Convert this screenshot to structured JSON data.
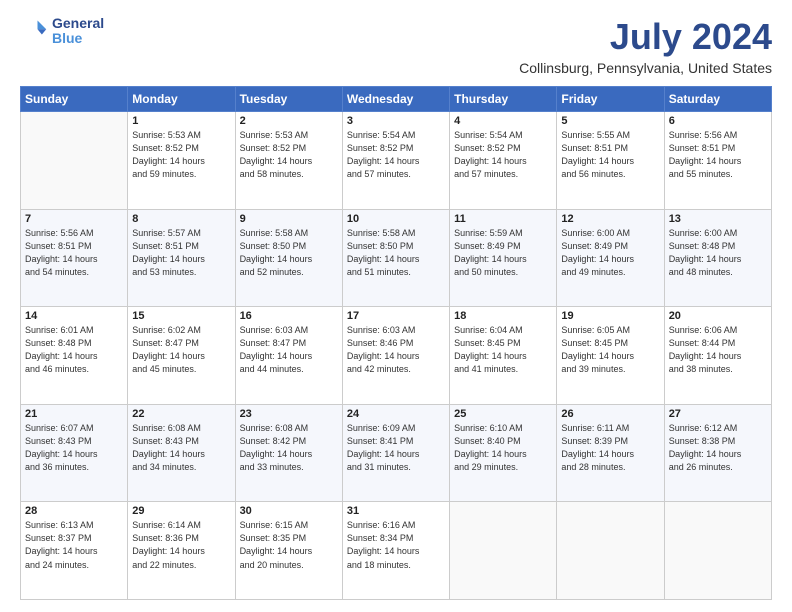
{
  "logo": {
    "line1": "General",
    "line2": "Blue"
  },
  "title": "July 2024",
  "subtitle": "Collinsburg, Pennsylvania, United States",
  "days_of_week": [
    "Sunday",
    "Monday",
    "Tuesday",
    "Wednesday",
    "Thursday",
    "Friday",
    "Saturday"
  ],
  "weeks": [
    [
      {
        "day": "",
        "info": ""
      },
      {
        "day": "1",
        "info": "Sunrise: 5:53 AM\nSunset: 8:52 PM\nDaylight: 14 hours\nand 59 minutes."
      },
      {
        "day": "2",
        "info": "Sunrise: 5:53 AM\nSunset: 8:52 PM\nDaylight: 14 hours\nand 58 minutes."
      },
      {
        "day": "3",
        "info": "Sunrise: 5:54 AM\nSunset: 8:52 PM\nDaylight: 14 hours\nand 57 minutes."
      },
      {
        "day": "4",
        "info": "Sunrise: 5:54 AM\nSunset: 8:52 PM\nDaylight: 14 hours\nand 57 minutes."
      },
      {
        "day": "5",
        "info": "Sunrise: 5:55 AM\nSunset: 8:51 PM\nDaylight: 14 hours\nand 56 minutes."
      },
      {
        "day": "6",
        "info": "Sunrise: 5:56 AM\nSunset: 8:51 PM\nDaylight: 14 hours\nand 55 minutes."
      }
    ],
    [
      {
        "day": "7",
        "info": "Sunrise: 5:56 AM\nSunset: 8:51 PM\nDaylight: 14 hours\nand 54 minutes."
      },
      {
        "day": "8",
        "info": "Sunrise: 5:57 AM\nSunset: 8:51 PM\nDaylight: 14 hours\nand 53 minutes."
      },
      {
        "day": "9",
        "info": "Sunrise: 5:58 AM\nSunset: 8:50 PM\nDaylight: 14 hours\nand 52 minutes."
      },
      {
        "day": "10",
        "info": "Sunrise: 5:58 AM\nSunset: 8:50 PM\nDaylight: 14 hours\nand 51 minutes."
      },
      {
        "day": "11",
        "info": "Sunrise: 5:59 AM\nSunset: 8:49 PM\nDaylight: 14 hours\nand 50 minutes."
      },
      {
        "day": "12",
        "info": "Sunrise: 6:00 AM\nSunset: 8:49 PM\nDaylight: 14 hours\nand 49 minutes."
      },
      {
        "day": "13",
        "info": "Sunrise: 6:00 AM\nSunset: 8:48 PM\nDaylight: 14 hours\nand 48 minutes."
      }
    ],
    [
      {
        "day": "14",
        "info": "Sunrise: 6:01 AM\nSunset: 8:48 PM\nDaylight: 14 hours\nand 46 minutes."
      },
      {
        "day": "15",
        "info": "Sunrise: 6:02 AM\nSunset: 8:47 PM\nDaylight: 14 hours\nand 45 minutes."
      },
      {
        "day": "16",
        "info": "Sunrise: 6:03 AM\nSunset: 8:47 PM\nDaylight: 14 hours\nand 44 minutes."
      },
      {
        "day": "17",
        "info": "Sunrise: 6:03 AM\nSunset: 8:46 PM\nDaylight: 14 hours\nand 42 minutes."
      },
      {
        "day": "18",
        "info": "Sunrise: 6:04 AM\nSunset: 8:45 PM\nDaylight: 14 hours\nand 41 minutes."
      },
      {
        "day": "19",
        "info": "Sunrise: 6:05 AM\nSunset: 8:45 PM\nDaylight: 14 hours\nand 39 minutes."
      },
      {
        "day": "20",
        "info": "Sunrise: 6:06 AM\nSunset: 8:44 PM\nDaylight: 14 hours\nand 38 minutes."
      }
    ],
    [
      {
        "day": "21",
        "info": "Sunrise: 6:07 AM\nSunset: 8:43 PM\nDaylight: 14 hours\nand 36 minutes."
      },
      {
        "day": "22",
        "info": "Sunrise: 6:08 AM\nSunset: 8:43 PM\nDaylight: 14 hours\nand 34 minutes."
      },
      {
        "day": "23",
        "info": "Sunrise: 6:08 AM\nSunset: 8:42 PM\nDaylight: 14 hours\nand 33 minutes."
      },
      {
        "day": "24",
        "info": "Sunrise: 6:09 AM\nSunset: 8:41 PM\nDaylight: 14 hours\nand 31 minutes."
      },
      {
        "day": "25",
        "info": "Sunrise: 6:10 AM\nSunset: 8:40 PM\nDaylight: 14 hours\nand 29 minutes."
      },
      {
        "day": "26",
        "info": "Sunrise: 6:11 AM\nSunset: 8:39 PM\nDaylight: 14 hours\nand 28 minutes."
      },
      {
        "day": "27",
        "info": "Sunrise: 6:12 AM\nSunset: 8:38 PM\nDaylight: 14 hours\nand 26 minutes."
      }
    ],
    [
      {
        "day": "28",
        "info": "Sunrise: 6:13 AM\nSunset: 8:37 PM\nDaylight: 14 hours\nand 24 minutes."
      },
      {
        "day": "29",
        "info": "Sunrise: 6:14 AM\nSunset: 8:36 PM\nDaylight: 14 hours\nand 22 minutes."
      },
      {
        "day": "30",
        "info": "Sunrise: 6:15 AM\nSunset: 8:35 PM\nDaylight: 14 hours\nand 20 minutes."
      },
      {
        "day": "31",
        "info": "Sunrise: 6:16 AM\nSunset: 8:34 PM\nDaylight: 14 hours\nand 18 minutes."
      },
      {
        "day": "",
        "info": ""
      },
      {
        "day": "",
        "info": ""
      },
      {
        "day": "",
        "info": ""
      }
    ]
  ]
}
